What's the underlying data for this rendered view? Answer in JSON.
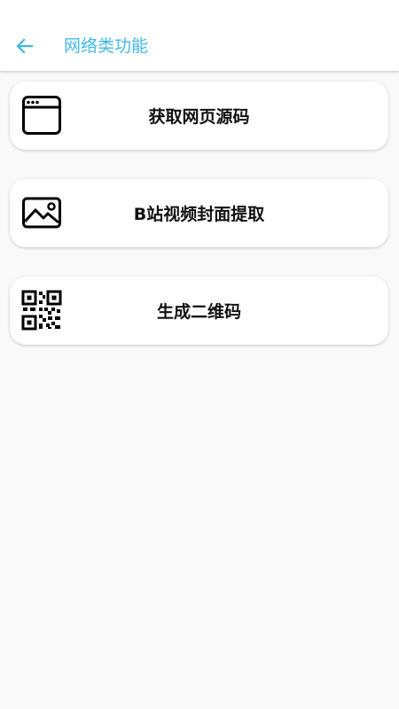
{
  "header": {
    "title": "网络类功能",
    "back_icon": "arrow-left-icon",
    "accent_color": "#42b8e6"
  },
  "cards": [
    {
      "label": "获取网页源码",
      "icon": "browser-window-icon"
    },
    {
      "label": "B站视频封面提取",
      "icon": "image-icon"
    },
    {
      "label": "生成二维码",
      "icon": "qr-code-icon"
    }
  ]
}
